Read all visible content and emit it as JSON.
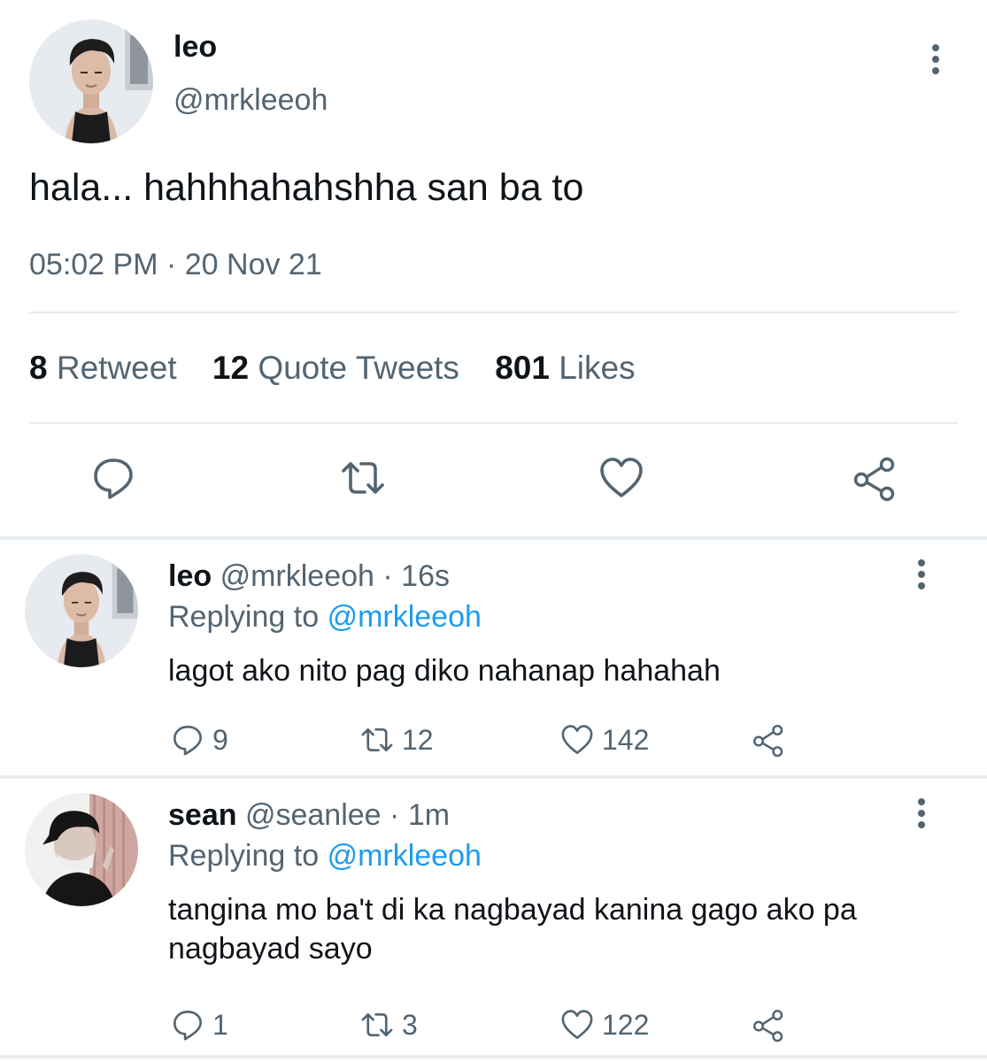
{
  "main_tweet": {
    "name": "leo",
    "handle": "@mrkleeoh",
    "text": "hala... hahhhahahshha san ba to",
    "timestamp": "05:02 PM · 20 Nov 21",
    "stats": {
      "retweets_count": "8",
      "retweets_label": "Retweet",
      "quotes_count": "12",
      "quotes_label": "Quote Tweets",
      "likes_count": "801",
      "likes_label": "Likes"
    },
    "actions": [
      "reply-icon",
      "retweet-icon",
      "heart-icon",
      "share-icon"
    ]
  },
  "replies": [
    {
      "name": "leo",
      "handle": "@mrkleeoh",
      "age": "16s",
      "replying_label": "Replying to",
      "replying_to": "@mrkleeoh",
      "text": "lagot ako nito pag diko nahanap hahahah",
      "reply_count": "9",
      "retweet_count": "12",
      "like_count": "142"
    },
    {
      "name": "sean",
      "handle": "@seanlee",
      "age": "1m",
      "replying_label": "Replying to",
      "replying_to": "@mrkleeoh",
      "text": "tangina mo ba't di ka nagbayad kanina gago ako pa nagbayad sayo",
      "reply_count": "1",
      "retweet_count": "3",
      "like_count": "122"
    }
  ],
  "colors": {
    "text_primary": "#0f1419",
    "text_secondary": "#536471",
    "link": "#1d9bf0",
    "divider": "#e6ecf0"
  }
}
